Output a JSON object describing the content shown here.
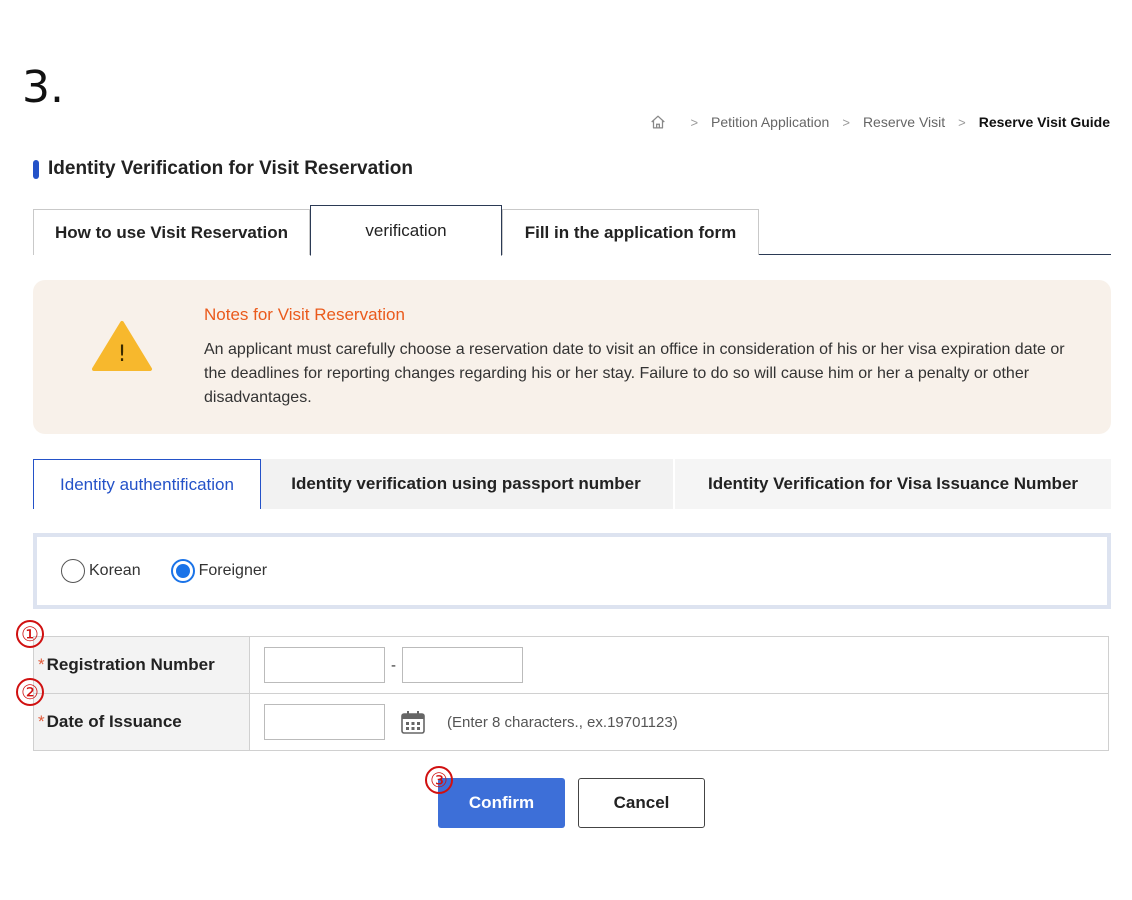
{
  "step": {
    "label": "3."
  },
  "breadcrumb": {
    "home_icon": "home-icon",
    "items": [
      "Petition Application",
      "Reserve Visit",
      "Reserve Visit Guide"
    ]
  },
  "page": {
    "title": "Identity Verification for Visit Reservation"
  },
  "main_tabs": [
    {
      "label": "How to use Visit Reservation"
    },
    {
      "label": "verification"
    },
    {
      "label": "Fill in the application form"
    }
  ],
  "notice": {
    "icon": "warning-icon",
    "title": "Notes for Visit Reservation",
    "body": "An applicant must carefully choose a reservation date to visit an office in consideration of his or her visa expiration date or the deadlines for reporting changes regarding his or her stay. Failure to do so will cause him or her a penalty or other disadvantages."
  },
  "sub_tabs": [
    {
      "label": "Identity authentification"
    },
    {
      "label": "Identity verification using passport number"
    },
    {
      "label": "Identity Verification for Visa Issuance Number"
    }
  ],
  "radio": {
    "options": [
      {
        "label": "Korean",
        "checked": false
      },
      {
        "label": "Foreigner",
        "checked": true
      }
    ]
  },
  "form": {
    "required_mark": "*",
    "registration_number": {
      "label": "Registration Number",
      "separator": "-",
      "value1": "",
      "value2": ""
    },
    "date_of_issuance": {
      "label": "Date of Issuance",
      "value": "",
      "hint": "(Enter 8 characters., ex.19701123)",
      "icon": "calendar-icon"
    }
  },
  "markers": [
    "①",
    "②",
    "③"
  ],
  "buttons": {
    "confirm": "Confirm",
    "cancel": "Cancel"
  },
  "colors": {
    "accent": "#2452c8",
    "confirm_bg": "#3d6fd8",
    "notice_title": "#ea5a1c",
    "notice_bg": "#f8f1ea",
    "marker": "#d01010"
  }
}
